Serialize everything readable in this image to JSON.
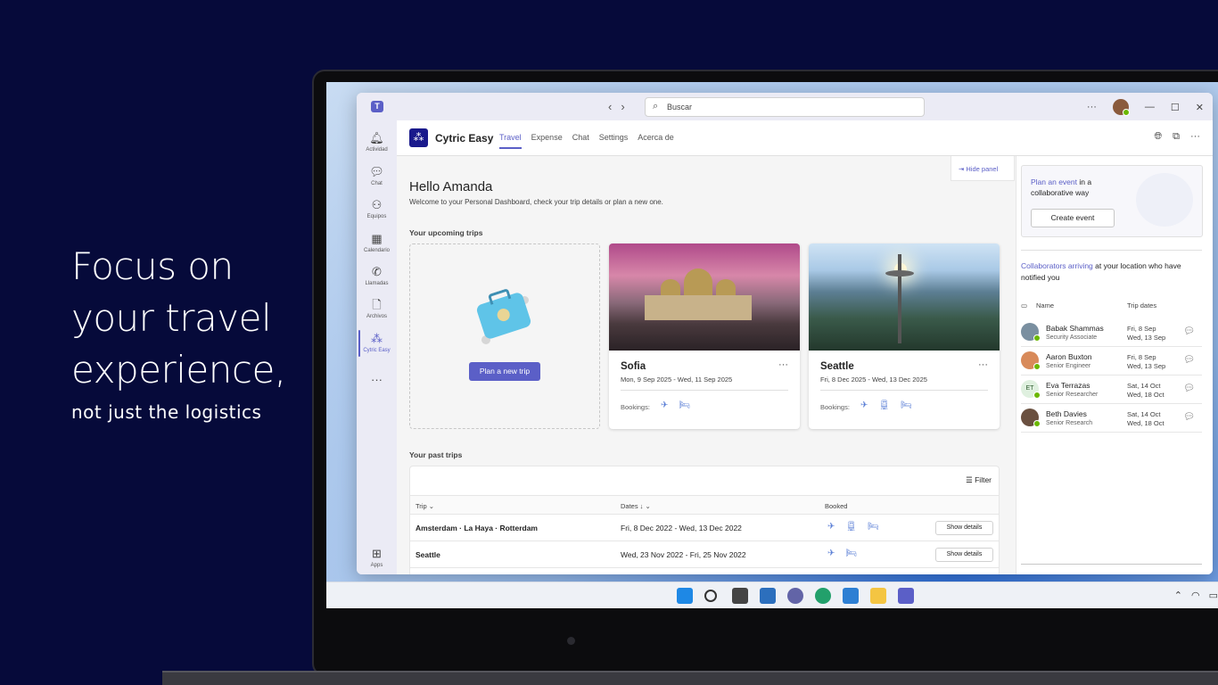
{
  "hero": {
    "line1": "Focus on",
    "line2": "your travel",
    "line3": "experience,",
    "subline": "not just the logistics"
  },
  "titlebar": {
    "search_placeholder": "Buscar"
  },
  "rail": [
    {
      "label": "Actividad",
      "icon": "bell-icon"
    },
    {
      "label": "Chat",
      "icon": "chat-icon"
    },
    {
      "label": "Equipos",
      "icon": "teams-icon"
    },
    {
      "label": "Calendario",
      "icon": "calendar-icon"
    },
    {
      "label": "Llamadas",
      "icon": "phone-icon"
    },
    {
      "label": "Archivos",
      "icon": "file-icon"
    },
    {
      "label": "Cytric Easy",
      "icon": "cytric-icon"
    },
    {
      "label": "Apps",
      "icon": "apps-icon"
    }
  ],
  "app": {
    "name": "Cytric Easy",
    "tabs": [
      "Travel",
      "Expense",
      "Chat",
      "Settings",
      "Acerca de"
    ],
    "active_tab": "Travel"
  },
  "main": {
    "hello": "Hello Amanda",
    "welcome": "Welcome to your Personal Dashboard, check your trip details or plan a new one.",
    "upcoming_title": "Your upcoming trips",
    "plan_button": "Plan a new trip",
    "past_title": "Your past trips",
    "hide_panel": "Hide panel"
  },
  "upcoming_trips": [
    {
      "city": "Sofia",
      "dates": "Mon, 9 Sep 2025 - Wed, 11 Sep 2025",
      "bookings_label": "Bookings:"
    },
    {
      "city": "Seattle",
      "dates": "Fri, 8 Dec 2025 - Wed, 13 Dec 2025",
      "bookings_label": "Bookings:"
    }
  ],
  "past_trips": {
    "filter_label": "Filter",
    "headers": {
      "trip": "Trip",
      "dates": "Dates",
      "booked": "Booked"
    },
    "rows": [
      {
        "trip": "Amsterdam · La Haya · Rotterdam",
        "dates": "Fri, 8 Dec 2022 - Wed, 13 Dec 2022",
        "action": "Show details"
      },
      {
        "trip": "Seattle",
        "dates": "Wed, 23 Nov 2022 - Fri, 25 Nov 2022",
        "action": "Show details"
      }
    ]
  },
  "panel": {
    "event_link": "Plan an event",
    "event_text": " in a collaborative way",
    "create_event": "Create event",
    "collab_link": "Collaborators arriving",
    "collab_text": " at your location who have notified you",
    "col_name": "Name",
    "col_dates": "Trip dates",
    "people": [
      {
        "name": "Babak Shammas",
        "role": "Security Associate",
        "date1": "Fri, 8 Sep",
        "date2": "Wed, 13 Sep",
        "color": "#7a8fa0",
        "initials": ""
      },
      {
        "name": "Aaron Buxton",
        "role": "Senior Engineer",
        "date1": "Fri, 8 Sep",
        "date2": "Wed, 13 Sep",
        "color": "#d88a5a",
        "initials": ""
      },
      {
        "name": "Eva Terrazas",
        "role": "Senior Researcher",
        "date1": "Sat, 14 Oct",
        "date2": "Wed, 18 Oct",
        "color": "#dff0df",
        "initials": "ET"
      },
      {
        "name": "Beth Davies",
        "role": "Senior Research",
        "date1": "Sat, 14 Oct",
        "date2": "Wed, 18 Oct",
        "color": "#6a5040",
        "initials": ""
      }
    ]
  },
  "colors": {
    "brand": "#5b5fc7",
    "background": "#060a3a"
  }
}
